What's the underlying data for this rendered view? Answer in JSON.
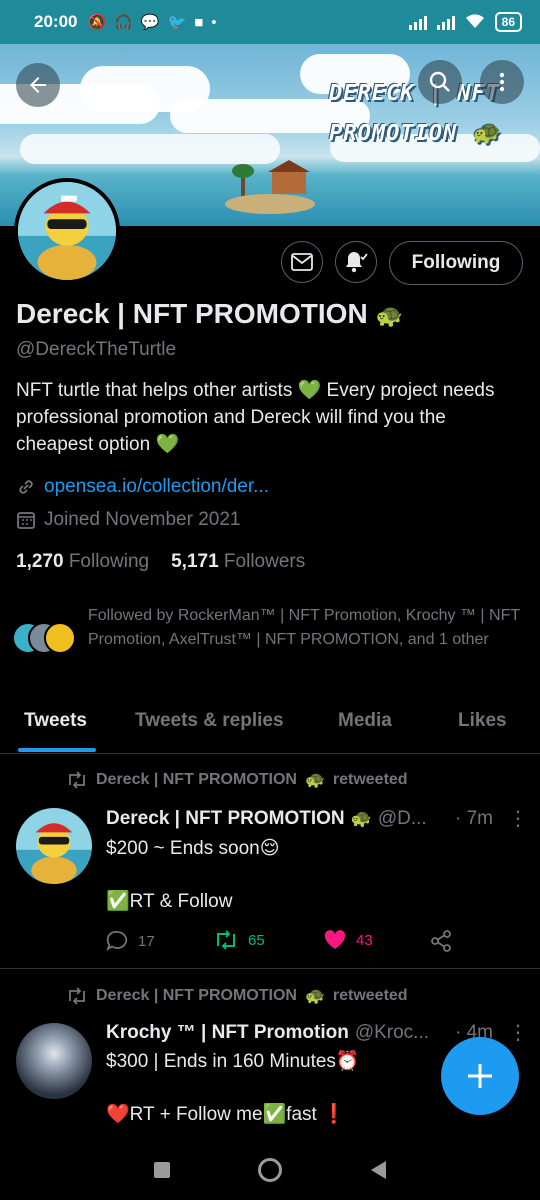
{
  "status_bar": {
    "time": "20:00",
    "battery": "86",
    "icons": [
      "mute-icon",
      "headset-icon",
      "messenger-icon",
      "twitter-icon",
      "video-icon"
    ],
    "dot": "•"
  },
  "banner": {
    "title_line1": "DERECK | NFT",
    "title_line2": "PROMOTION 🐢"
  },
  "profile": {
    "name": "Dereck | NFT PROMOTION",
    "name_emoji": "🐢",
    "handle": "@DereckTheTurtle",
    "bio_1": "NFT turtle that helps other artists ",
    "bio_heart": "💚",
    "bio_2": " Every project needs professional promotion and Dereck will find you the cheapest option ",
    "link": "opensea.io/collection/der...",
    "joined": "Joined November 2021",
    "following_count": "1,270",
    "following_label": "Following",
    "followers_count": "5,171",
    "followers_label": "Followers",
    "followed_by": "Followed by RockerMan™ | NFT Promotion, Krochy ™ | NFT Promotion, AxelTrust™ | NFT PROMOTION, and 1 other",
    "following_button": "Following"
  },
  "tabs": [
    "Tweets",
    "Tweets & replies",
    "Media",
    "Likes"
  ],
  "tweets": [
    {
      "retweeted_by": "Dereck | NFT PROMOTION",
      "retweeted_emoji": "🐢",
      "retweeted_suffix": "retweeted",
      "author": "Dereck | NFT PROMOTION",
      "author_emoji": "🐢",
      "handle": "@D...",
      "time": "· 7m",
      "line1": "$200 ~ Ends soon😌",
      "line2": "✅RT & Follow",
      "replies": "17",
      "retweets": "65",
      "likes": "43"
    },
    {
      "retweeted_by": "Dereck | NFT PROMOTION",
      "retweeted_emoji": "🐢",
      "retweeted_suffix": "retweeted",
      "author": "Krochy ™ | NFT Promotion",
      "handle": "@Kroc...",
      "time": "· 4m",
      "line1": "$300 | Ends in 160 Minutes⏰",
      "line2": "❤️RT + Follow me✅fast ❗"
    }
  ],
  "colors": {
    "accent": "#1d9bf0",
    "retweet_green": "#00ba7c",
    "like_pink": "#f91880",
    "status_bar": "#1f8a9a"
  }
}
